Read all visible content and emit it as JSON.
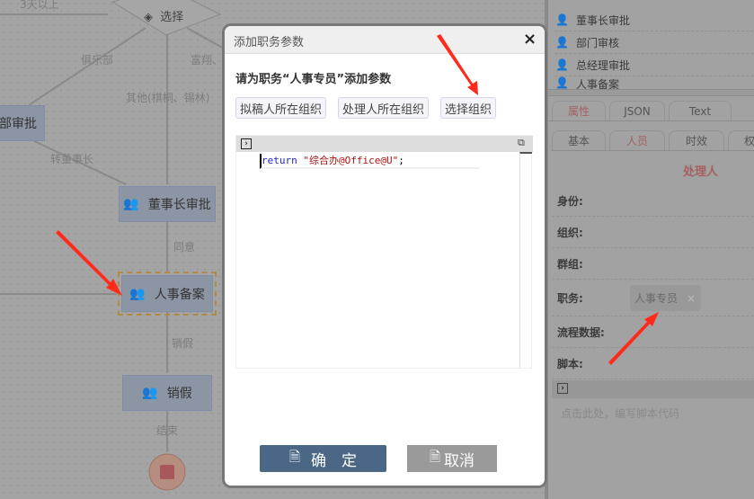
{
  "flow": {
    "edge_labels": {
      "over3": "3天以上",
      "club": "俱乐部",
      "fuxiang": "富翔、",
      "other": "其他(棋桐、锡林)",
      "to_chairman": "转董事长",
      "agree": "同意",
      "leave": "销假",
      "end": "结束"
    },
    "decision": "选择",
    "nodes": {
      "dept": "部审批",
      "chairman": "董事长审批",
      "hr": "人事备案",
      "cancel": "销假"
    }
  },
  "right_panel": {
    "list": [
      "董事长审批",
      "部门审核",
      "总经理审批",
      "人事备案"
    ],
    "tabs": [
      "属性",
      "JSON",
      "Text"
    ],
    "subtabs": [
      "基本",
      "人员",
      "时效",
      "权限"
    ],
    "section_title": "处理人",
    "fields": [
      "身份:",
      "组织:",
      "群组:",
      "职务:",
      "流程数据:",
      "脚本:"
    ],
    "duty_tag": "人事专员",
    "script_placeholder": "点击此处，编写脚本代码"
  },
  "dialog": {
    "title": "添加职务参数",
    "close": "×",
    "prompt": "请为职务“人事专员”添加参数",
    "options": [
      "拟稿人所在组织",
      "处理人所在组织",
      "选择组织"
    ],
    "code": {
      "keyword": "return",
      "string": "\"综合办@Office@U\"",
      "end": ";"
    },
    "ok": "确　定",
    "cancel": "取消"
  },
  "colors": {
    "ok": "#4a6886",
    "cancel": "#9a9a9a",
    "arrow": "#ff2a1a"
  }
}
